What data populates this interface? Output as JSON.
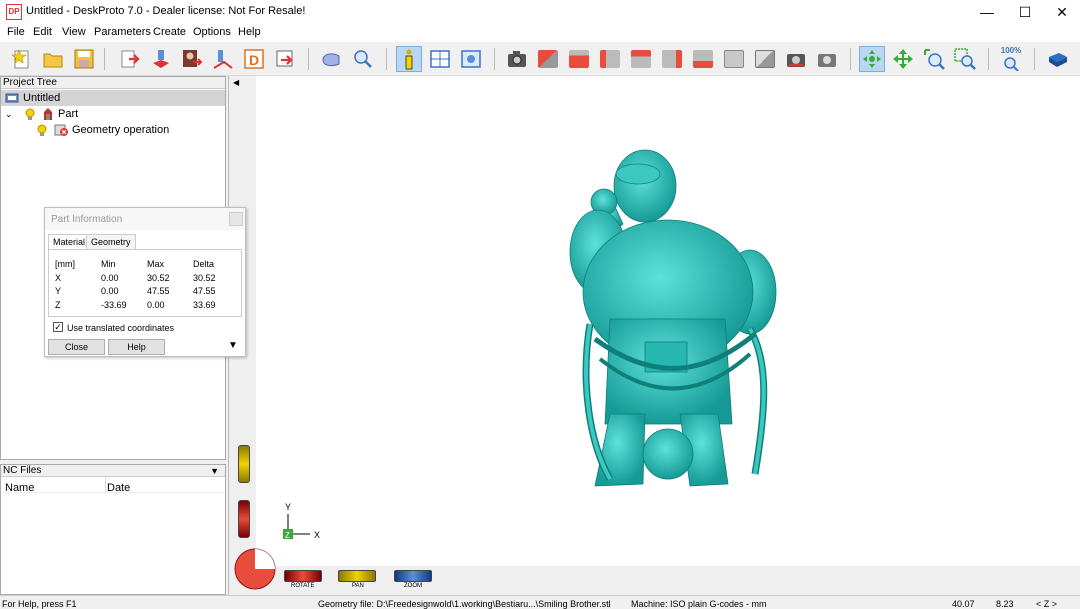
{
  "window": {
    "title": "Untitled - DeskProto 7.0 - Dealer license: Not For Resale!",
    "app_icon": "DP",
    "controls": [
      "minimize-icon",
      "maximize-icon",
      "close-icon"
    ]
  },
  "menu": {
    "items": [
      "File",
      "Edit",
      "View",
      "Parameters",
      "Create",
      "Options",
      "Help"
    ]
  },
  "toolbar": {
    "groups": [
      [
        "new-file-icon",
        "open-folder-icon",
        "save-icon"
      ],
      [
        "import-geometry-icon",
        "operation-wizard-icon",
        "bitmap-icon",
        "vector-icon",
        "dxf-icon",
        "export-icon"
      ],
      [
        "preview-icon",
        "search-zoom-icon"
      ],
      [
        "info-icon",
        "layout-icon",
        "display-icon"
      ],
      [
        "camera-icon",
        "view-iso-icon",
        "view-front-icon",
        "view-back-icon",
        "view-left-icon",
        "view-right-icon",
        "view-top-icon",
        "view-bottom-icon",
        "view-grey-icon",
        "photo-icon",
        "render-icon"
      ],
      [
        "rotate-view-icon",
        "pan-view-icon",
        "zoom-view-icon",
        "zoom-window-icon"
      ],
      [
        "zoom-100-icon"
      ],
      [
        "help-book-icon"
      ]
    ],
    "zoom_label": "100%",
    "active": "info-icon"
  },
  "project_tree": {
    "header": "Project Tree",
    "items": [
      {
        "label": "Untitled",
        "level": 0,
        "icon": "project-icon"
      },
      {
        "label": "Part",
        "level": 1,
        "icon": "part-icon"
      },
      {
        "label": "Geometry operation",
        "level": 2,
        "icon": "operation-icon"
      }
    ]
  },
  "nc_files": {
    "header": "NC Files",
    "columns": [
      "Name",
      "Date"
    ]
  },
  "part_information": {
    "title": "Part Information",
    "tabs": [
      "Material",
      "Geometry"
    ],
    "active_tab": "Material",
    "columns": [
      "[mm]",
      "Min",
      "Max",
      "Delta"
    ],
    "rows": [
      [
        "X",
        "0.00",
        "30.52",
        "30.52"
      ],
      [
        "Y",
        "0.00",
        "47.55",
        "47.55"
      ],
      [
        "Z",
        "-33.69",
        "0.00",
        "33.69"
      ]
    ],
    "checkbox_label": "Use translated coordinates",
    "checkbox_checked": true,
    "buttons": {
      "close": "Close",
      "help": "Help"
    }
  },
  "viewport": {
    "axis_labels": {
      "y": "Y",
      "z": "Z",
      "x": "X"
    },
    "controls": {
      "rotate": "ROTATE",
      "pan": "PAN",
      "zoom": "ZOOM"
    },
    "model_color": "#1fb2ad"
  },
  "status": {
    "help": "For Help, press F1",
    "geometry_file": "Geometry file: D:\\Freedesignwold\\1.working\\Bestiaru...\\Smiling Brother.stl",
    "machine": "Machine: ISO plain G-codes - mm",
    "coord1": "40.07",
    "coord2": "8.23",
    "axis_mode": "< Z >"
  }
}
